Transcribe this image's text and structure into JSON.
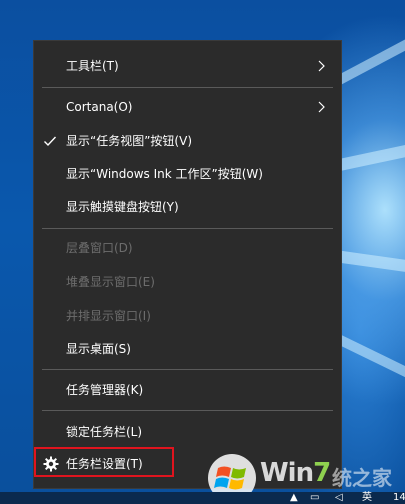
{
  "menu": {
    "items": [
      {
        "label": "工具栏(T)",
        "has_submenu": true
      },
      {
        "label": "Cortana(O)",
        "has_submenu": true
      },
      {
        "label": "显示“任务视图”按钮(V)",
        "checked": true
      },
      {
        "label": "显示“Windows Ink 工作区”按钮(W)"
      },
      {
        "label": "显示触摸键盘按钮(Y)"
      },
      {
        "label": "层叠窗口(D)",
        "disabled": true
      },
      {
        "label": "堆叠显示窗口(E)",
        "disabled": true
      },
      {
        "label": "并排显示窗口(I)",
        "disabled": true
      },
      {
        "label": "显示桌面(S)"
      },
      {
        "label": "任务管理器(K)"
      },
      {
        "label": "锁定任务栏(L)"
      },
      {
        "label": "任务栏设置(T)",
        "icon": "gear-icon",
        "highlighted": true
      }
    ]
  },
  "watermark": {
    "text_win": "Win",
    "text_seven": "7",
    "text_suffix": "统之家"
  },
  "tray": {
    "clock_partial": "14",
    "lang_partial": "英"
  },
  "colors": {
    "menu_bg": "#2b2b2b",
    "highlight_border": "#e0141e",
    "disabled_text": "#6d6d6d"
  }
}
